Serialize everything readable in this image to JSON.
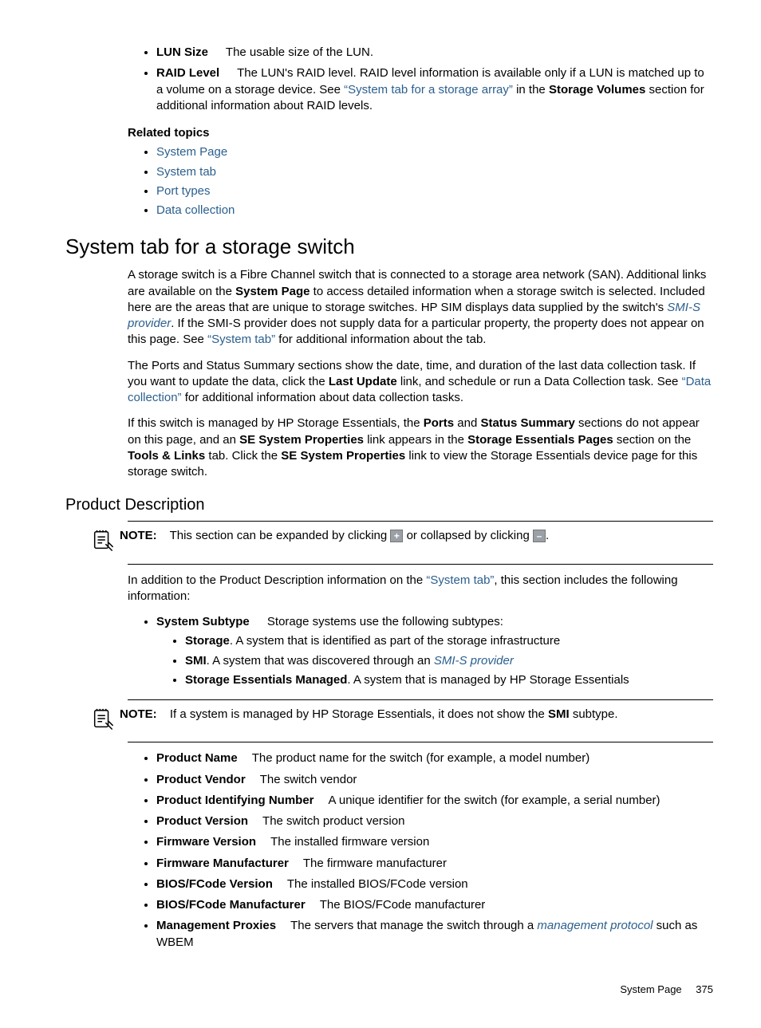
{
  "top_bullets": {
    "lun_size": {
      "term": "LUN Size",
      "text": "The usable size of the LUN."
    },
    "raid": {
      "term": "RAID Level",
      "t1": "The LUN's RAID level. RAID level information is available only if a LUN is matched up to a volume on a storage device. See ",
      "link1": "“System tab for a storage array”",
      "t2": " in the ",
      "b1": "Storage Volumes",
      "t3": " section for additional information about RAID levels."
    }
  },
  "related": {
    "heading": "Related topics",
    "items": [
      "System Page",
      "System tab",
      "Port types",
      "Data collection"
    ]
  },
  "h2": "System tab for a storage switch",
  "p1": {
    "t1": "A storage switch is a Fibre Channel switch that is connected to a storage area network (SAN). Additional links are available on the ",
    "b1": "System Page",
    "t2": " to access detailed information when a storage switch is selected. Included here are the areas that are unique to storage switches. HP SIM displays data supplied by the switch's ",
    "l1": "SMI-S provider",
    "t3": ". If the SMI-S provider does not supply data for a particular property, the property does not appear on this page. See ",
    "l2": "“System tab”",
    "t4": " for additional information about the tab."
  },
  "p2": {
    "t1": "The Ports and Status Summary sections show the date, time, and duration of the last data collection task. If you want to update the data, click the ",
    "b1": "Last Update",
    "t2": " link, and schedule or run a Data Collection task. See ",
    "l1": "“Data collection”",
    "t3": " for additional information about data collection tasks."
  },
  "p3": {
    "t1": "If this switch is managed by HP Storage Essentials, the ",
    "b1": "Ports",
    "t2": " and ",
    "b2": "Status Summary",
    "t3": " sections do not appear on this page, and an ",
    "b3": "SE System Properties",
    "t4": " link appears in the ",
    "b4": "Storage Essentials Pages",
    "t5": " section on the ",
    "b5": "Tools & Links",
    "t6": " tab. Click the ",
    "b6": "SE System Properties",
    "t7": " link to view the Storage Essentials device page for this storage switch."
  },
  "h3": "Product Description",
  "note1": {
    "label": "NOTE:",
    "t1": "This section can be expanded by clicking ",
    "plus": "+",
    "t2": " or collapsed by clicking ",
    "minus": "–",
    "t3": "."
  },
  "pd_intro": {
    "t1": "In addition to the Product Description information on the ",
    "l1": "“System tab”",
    "t2": ", this section includes the following information:"
  },
  "subtype": {
    "term": "System Subtype",
    "text": "Storage systems use the following subtypes:",
    "storage": {
      "b": "Storage",
      "t": ". A system that is identified as part of the storage infrastructure"
    },
    "smi": {
      "b": "SMI",
      "t1": ". A system that was discovered through an ",
      "l": "SMI-S provider"
    },
    "sem": {
      "b": "Storage Essentials Managed",
      "t": ". A system that is managed by HP Storage Essentials"
    }
  },
  "note2": {
    "label": "NOTE:",
    "t1": "If a system is managed by HP Storage Essentials, it does not show the ",
    "b1": "SMI",
    "t2": " subtype."
  },
  "fields": {
    "pname": {
      "term": "Product Name",
      "text": "The product name for the switch (for example, a model number)"
    },
    "pvendor": {
      "term": "Product Vendor",
      "text": "The switch vendor"
    },
    "pid": {
      "term": "Product Identifying Number",
      "text": "A unique identifier for the switch (for example, a serial number)"
    },
    "pver": {
      "term": "Product Version",
      "text": "The switch product version"
    },
    "fwver": {
      "term": "Firmware Version",
      "text": "The installed firmware version"
    },
    "fwman": {
      "term": "Firmware Manufacturer",
      "text": "The firmware manufacturer"
    },
    "biosv": {
      "term": "BIOS/FCode Version",
      "text": "The installed BIOS/FCode version"
    },
    "biosm": {
      "term": "BIOS/FCode Manufacturer",
      "text": "The BIOS/FCode manufacturer"
    },
    "mprox": {
      "term": "Management Proxies",
      "t1": "The servers that manage the switch through a ",
      "l": "management protocol",
      "t2": " such as WBEM"
    }
  },
  "footer": {
    "label": "System Page",
    "page": "375"
  }
}
